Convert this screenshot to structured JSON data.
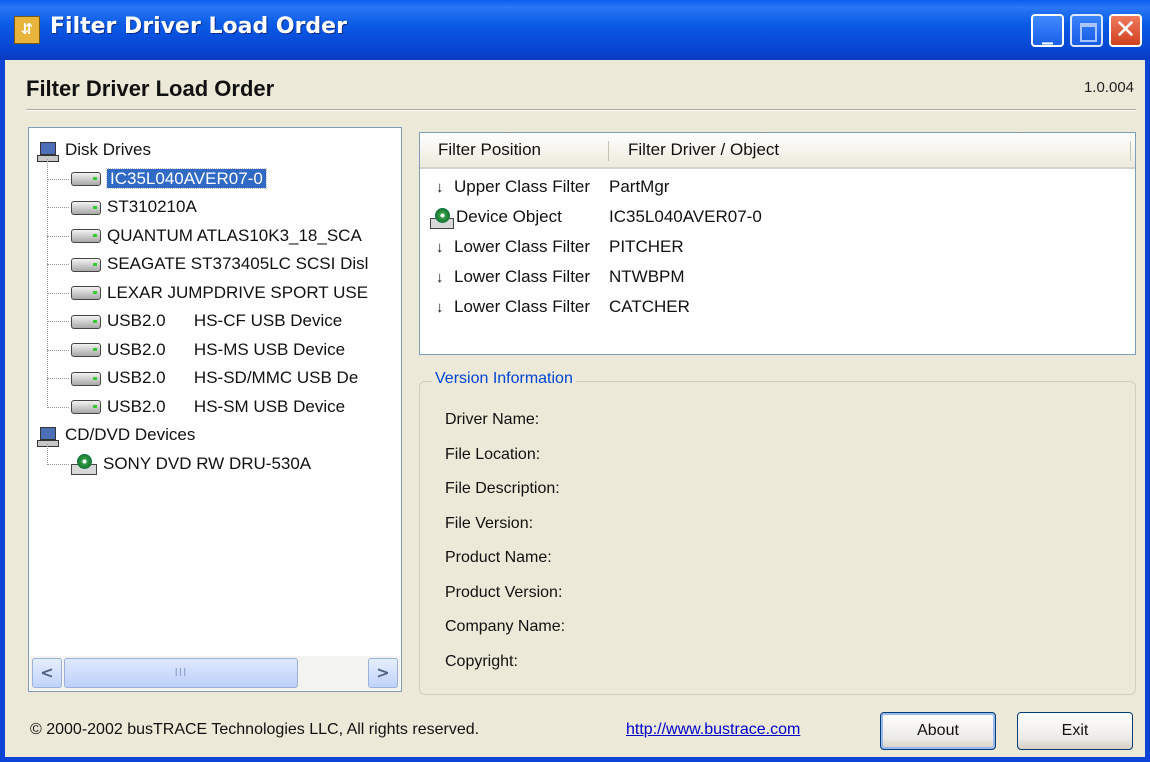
{
  "window": {
    "title": "Filter Driver Load Order",
    "controls": {
      "minimize": "_",
      "maximize": "",
      "close": "✕"
    }
  },
  "header": {
    "title": "Filter Driver Load Order",
    "version": "1.0.004"
  },
  "tree": {
    "groups": [
      {
        "label": "Disk Drives",
        "icon": "computer-icon",
        "items": [
          {
            "label": "IC35L040AVER07-0",
            "selected": true,
            "icon": "disk-drive-icon"
          },
          {
            "label": "ST310210A",
            "icon": "disk-drive-icon"
          },
          {
            "label": "QUANTUM ATLAS10K3_18_SCA",
            "icon": "disk-drive-icon"
          },
          {
            "label": "SEAGATE ST373405LC SCSI Disl",
            "icon": "disk-drive-icon"
          },
          {
            "label": "LEXAR JUMPDRIVE SPORT USE",
            "icon": "disk-drive-icon"
          },
          {
            "label": "USB2.0      HS-CF USB Device",
            "icon": "disk-drive-icon"
          },
          {
            "label": "USB2.0      HS-MS USB Device",
            "icon": "disk-drive-icon"
          },
          {
            "label": "USB2.0      HS-SD/MMC USB De",
            "icon": "disk-drive-icon"
          },
          {
            "label": "USB2.0      HS-SM USB Device",
            "icon": "disk-drive-icon"
          }
        ]
      },
      {
        "label": "CD/DVD Devices",
        "icon": "computer-icon",
        "items": [
          {
            "label": "SONY DVD RW DRU-530A",
            "icon": "cd-drive-icon"
          }
        ]
      }
    ],
    "scrollbar": {
      "left": "<",
      "right": ">",
      "thumb": "III"
    }
  },
  "filter_list": {
    "columns": [
      "Filter Position",
      "Filter Driver / Object"
    ],
    "rows": [
      {
        "position": "Upper Class Filter",
        "driver": "PartMgr",
        "icon": "down-arrow-icon"
      },
      {
        "position": "Device Object",
        "driver": "IC35L040AVER07-0",
        "icon": "device-object-icon"
      },
      {
        "position": "Lower Class Filter",
        "driver": "PITCHER",
        "icon": "down-arrow-icon"
      },
      {
        "position": "Lower Class Filter",
        "driver": "NTWBPM",
        "icon": "down-arrow-icon"
      },
      {
        "position": "Lower Class Filter",
        "driver": "CATCHER",
        "icon": "down-arrow-icon"
      }
    ],
    "arrow_glyph": "↓"
  },
  "version_info": {
    "title": "Version Information",
    "fields": [
      "Driver Name:",
      "File Location:",
      "File Description:",
      "File Version:",
      "Product Name:",
      "Product Version:",
      "Company Name:",
      "Copyright:"
    ]
  },
  "footer": {
    "copyright": "© 2000-2002 busTRACE Technologies LLC,  All rights reserved.",
    "link": "http://www.bustrace.com",
    "about_label": "About",
    "exit_label": "Exit"
  },
  "colors": {
    "titlebar": "#0a5ef2",
    "selection": "#316ac5",
    "groupTitle": "#0046d5",
    "link": "#0000cc"
  }
}
